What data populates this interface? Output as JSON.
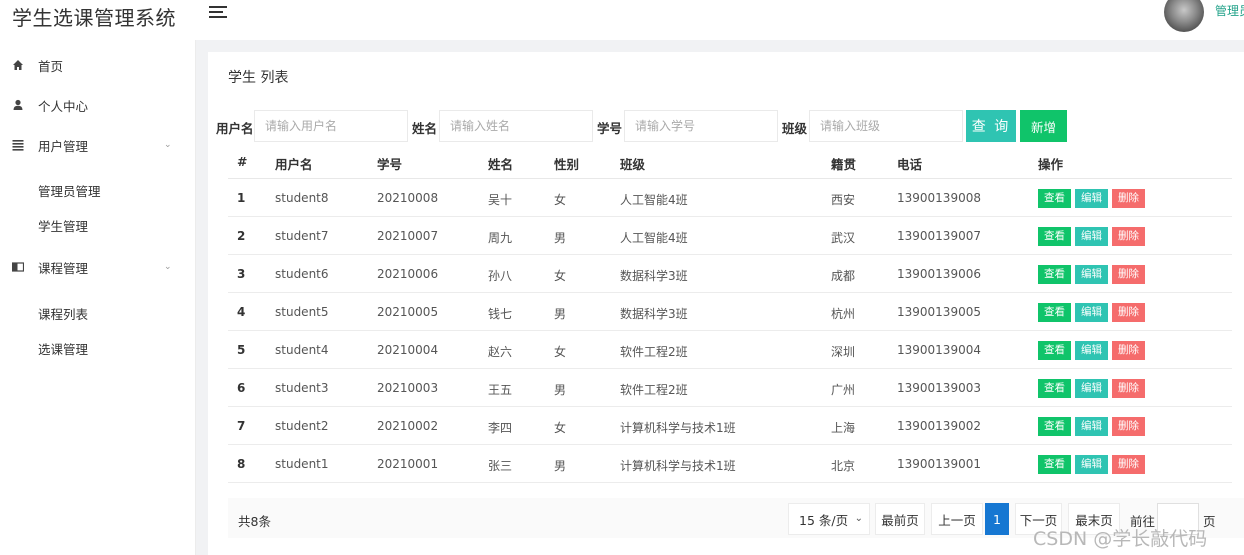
{
  "app": {
    "title": "学生选课管理系统",
    "user_label": "管理员"
  },
  "sidebar": {
    "home": "首页",
    "profile": "个人中心",
    "user_mgmt": "用户管理",
    "user_children": [
      "管理员管理",
      "学生管理"
    ],
    "course_mgmt": "课程管理",
    "course_children": [
      "课程列表",
      "选课管理"
    ]
  },
  "page": {
    "title": "学生 列表"
  },
  "search": {
    "username_label": "用户名",
    "username_placeholder": "请输入用户名",
    "name_label": "姓名",
    "name_placeholder": "请输入姓名",
    "student_no_label": "学号",
    "student_no_placeholder": "请输入学号",
    "class_label": "班级",
    "class_placeholder": "请输入班级",
    "search_button": "查 询",
    "add_button": "新增"
  },
  "table": {
    "headers": [
      "#",
      "用户名",
      "学号",
      "姓名",
      "性别",
      "班级",
      "籍贯",
      "电话",
      "操作"
    ],
    "action_labels": {
      "view": "查看",
      "edit": "编辑",
      "delete": "删除"
    },
    "rows": [
      [
        "1",
        "student8",
        "20210008",
        "吴十",
        "女",
        "人工智能4班",
        "西安",
        "13900139008"
      ],
      [
        "2",
        "student7",
        "20210007",
        "周九",
        "男",
        "人工智能4班",
        "武汉",
        "13900139007"
      ],
      [
        "3",
        "student6",
        "20210006",
        "孙八",
        "女",
        "数据科学3班",
        "成都",
        "13900139006"
      ],
      [
        "4",
        "student5",
        "20210005",
        "钱七",
        "男",
        "数据科学3班",
        "杭州",
        "13900139005"
      ],
      [
        "5",
        "student4",
        "20210004",
        "赵六",
        "女",
        "软件工程2班",
        "深圳",
        "13900139004"
      ],
      [
        "6",
        "student3",
        "20210003",
        "王五",
        "男",
        "软件工程2班",
        "广州",
        "13900139003"
      ],
      [
        "7",
        "student2",
        "20210002",
        "李四",
        "女",
        "计算机科学与技术1班",
        "上海",
        "13900139002"
      ],
      [
        "8",
        "student1",
        "20210001",
        "张三",
        "男",
        "计算机科学与技术1班",
        "北京",
        "13900139001"
      ]
    ]
  },
  "pagination": {
    "total": "共8条",
    "page_size": "15 条/页",
    "first": "最前页",
    "prev": "上一页",
    "current": "1",
    "next": "下一页",
    "last": "最末页",
    "goto_prefix": "前往",
    "goto_suffix": "页"
  },
  "watermark": "CSDN @学长敲代码",
  "colors": {
    "accent": "#2fc4b2",
    "primary_green": "#10c46a",
    "danger": "#f56c6c",
    "active_page": "#1677d2",
    "user_name": "#23a38a"
  },
  "icons": {
    "home": "home-icon",
    "profile": "user-icon",
    "user_mgmt": "list-icon",
    "course_mgmt": "book-icon",
    "menu": "hamburger-icon"
  }
}
